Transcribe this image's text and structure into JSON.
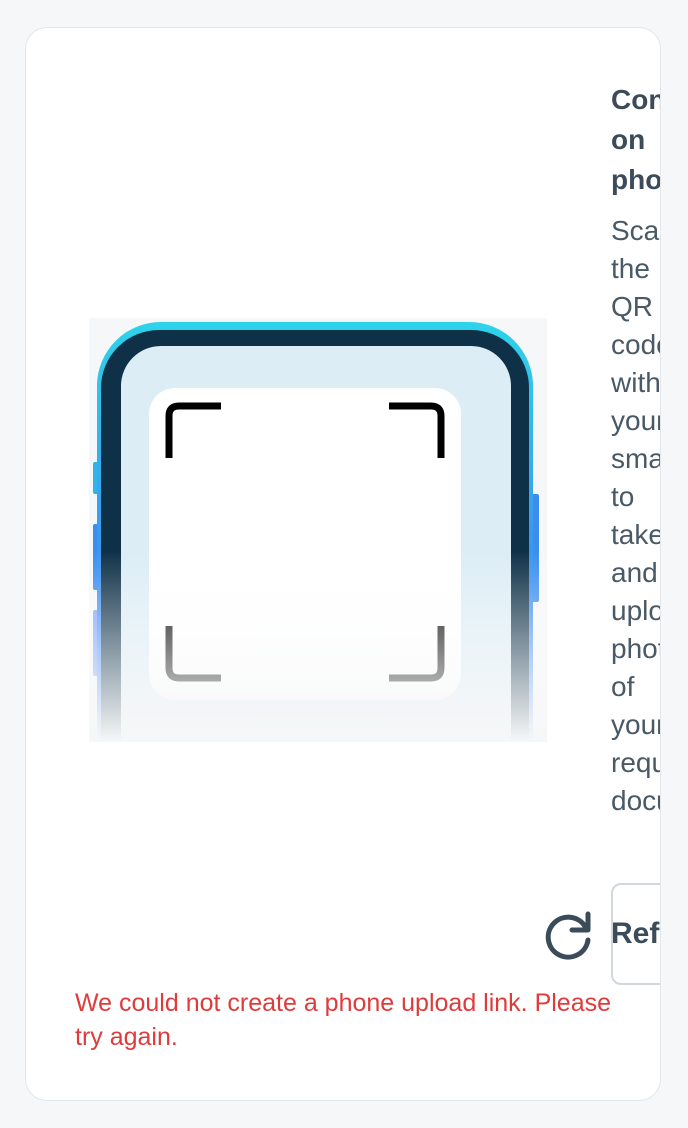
{
  "panel": {
    "title": "Continue on phone",
    "description": "Scan the QR code with your smartphone to take and upload photos of your required documents.",
    "refresh_label": "Refresh",
    "refresh_icon": "refresh-icon",
    "illustration_icon": "phone-scan-icon",
    "error_message": "We could not create a phone upload link. Please try again."
  },
  "colors": {
    "title": "#3b4b5a",
    "text": "#4a5966",
    "error": "#e03b3b",
    "phone_frame": "#0f3148",
    "phone_edge": "#2dc8e6",
    "phone_screen": "#dcedf5"
  }
}
